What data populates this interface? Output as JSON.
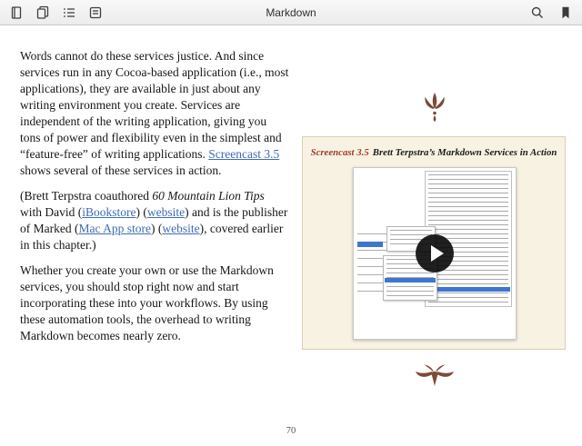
{
  "toolbar": {
    "title": "Markdown",
    "left_icons": [
      "library-icon",
      "books-icon",
      "toc-icon",
      "notes-icon"
    ],
    "right_icons": [
      "search-icon",
      "bookmark-icon"
    ]
  },
  "content": {
    "paragraphs": [
      {
        "segments": [
          {
            "type": "plain",
            "text": "Words cannot do these services justice. And since services run in any Cocoa-based application (i.e., most applications), they are available in just about any writing environment you create. Services are independent of the writing application, giving you tons of power and flexibility even in the simplest and “feature-free” of writing applications. "
          },
          {
            "type": "link",
            "text": "Screencast 3.5"
          },
          {
            "type": "plain",
            "text": " shows several of these services in action."
          }
        ]
      },
      {
        "segments": [
          {
            "type": "plain",
            "text": "(Brett Terpstra coauthored "
          },
          {
            "type": "italic",
            "text": "60 Mountain Lion Tips"
          },
          {
            "type": "plain",
            "text": " with David ("
          },
          {
            "type": "link",
            "text": "iBookstore"
          },
          {
            "type": "plain",
            "text": ") ("
          },
          {
            "type": "link",
            "text": "website"
          },
          {
            "type": "plain",
            "text": ") and is the publisher of Marked ("
          },
          {
            "type": "link",
            "text": "Mac App store"
          },
          {
            "type": "plain",
            "text": ") ("
          },
          {
            "type": "link",
            "text": "website"
          },
          {
            "type": "plain",
            "text": "), covered earlier in this chapter.)"
          }
        ]
      },
      {
        "segments": [
          {
            "type": "plain",
            "text": "Whether you create your own or use the Markdown services, you should stop right now and start incorporating these into your workflows. By using these automation tools, the overhead to writing Markdown becomes nearly zero."
          }
        ]
      }
    ],
    "figure": {
      "caption_label": "Screencast 3.5",
      "caption_title": "Brett Terpstra’s Markdown Services in Action",
      "media_icons": [
        "play-icon"
      ]
    },
    "ornaments": [
      "fleuron-top",
      "fleuron-bottom"
    ],
    "page_number": "70"
  },
  "colors": {
    "link": "#3d6cb4",
    "caption_label": "#a23b2a",
    "ornament": "#7c4a37",
    "figure_bg": "#f7f2e2",
    "figure_border": "#d8cfb4",
    "selection_blue": "#3b77d0"
  }
}
